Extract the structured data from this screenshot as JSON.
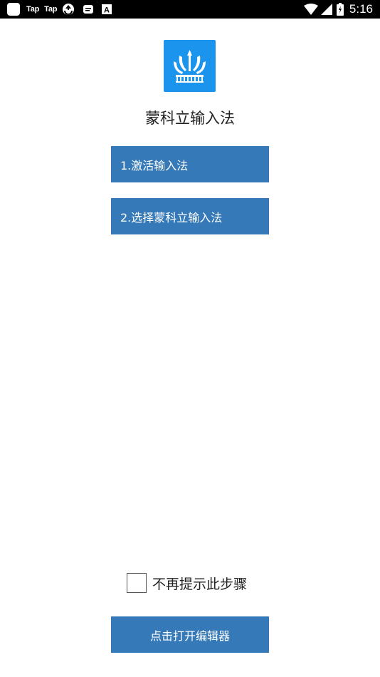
{
  "status_bar": {
    "time": "5:16",
    "tap_label_1": "Tap",
    "tap_label_2": "Tap",
    "keyboard_badge": "A"
  },
  "header": {
    "app_name": "蒙科立输入法"
  },
  "steps": [
    {
      "label": "1.激活输入法"
    },
    {
      "label": "2.选择蒙科立输入法"
    }
  ],
  "options": {
    "dont_show_again": "不再提示此步骤",
    "checked": false
  },
  "footer": {
    "open_editor_label": "点击打开编辑器"
  },
  "colors": {
    "button": "#3579b8",
    "logo_background": "#1a94ed",
    "status_bar": "#000000"
  }
}
